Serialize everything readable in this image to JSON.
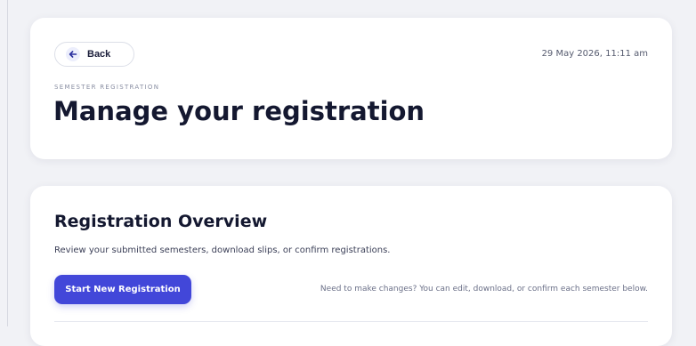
{
  "header": {
    "back_label": "Back",
    "datetime": "29 May 2026, 11:11 am",
    "eyebrow": "SEMESTER REGISTRATION",
    "title": "Manage your registration"
  },
  "overview": {
    "title": "Registration Overview",
    "description": "Review your submitted semesters, download slips, or confirm registrations.",
    "start_button_label": "Start New Registration",
    "hint": "Need to make changes? You can edit, download, or confirm each semester below."
  },
  "icons": {
    "back": "arrow-left-icon"
  },
  "colors": {
    "accent": "#4247d9",
    "background": "#f1f2f6",
    "card": "#ffffff",
    "heading": "#141830"
  }
}
